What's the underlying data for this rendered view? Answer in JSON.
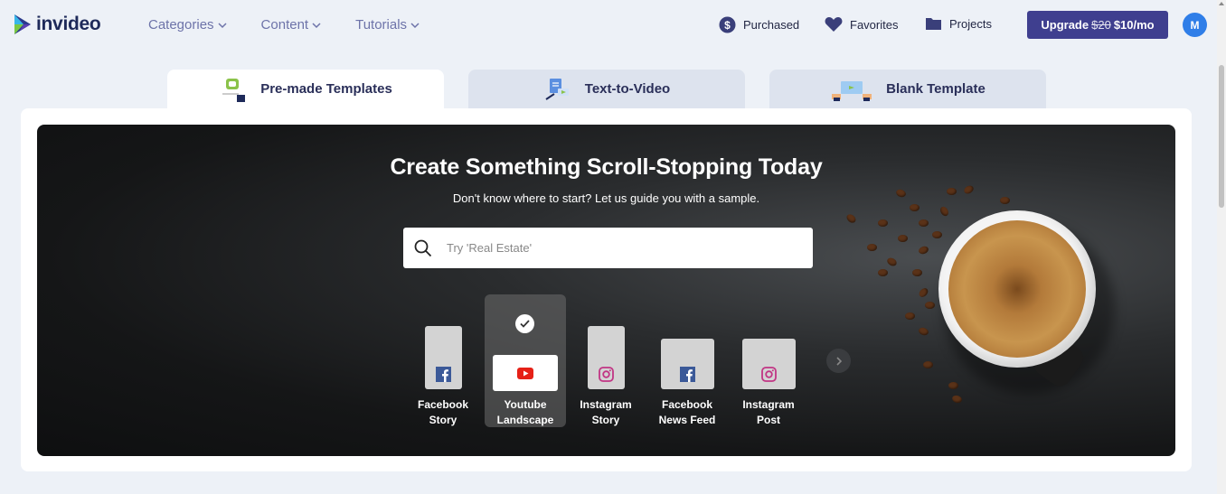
{
  "brand": {
    "name": "invideo"
  },
  "nav": {
    "items": [
      {
        "label": "Categories"
      },
      {
        "label": "Content"
      },
      {
        "label": "Tutorials"
      }
    ]
  },
  "account": {
    "purchased": "Purchased",
    "favorites": "Favorites",
    "projects": "Projects",
    "upgrade_prefix": "Upgrade",
    "upgrade_old_price": "$20",
    "upgrade_new_price": "$10/mo",
    "avatar_initial": "M"
  },
  "tabs": [
    {
      "label": "Pre-made Templates",
      "active": true
    },
    {
      "label": "Text-to-Video",
      "active": false
    },
    {
      "label": "Blank Template",
      "active": false
    }
  ],
  "hero": {
    "title": "Create Something Scroll-Stopping Today",
    "subtitle": "Don't know where to start? Let us guide you with a sample.",
    "search_placeholder": "Try 'Real Estate'"
  },
  "formats": [
    {
      "label_line1": "Facebook",
      "label_line2": "Story",
      "platform": "facebook-icon",
      "selected": false
    },
    {
      "label_line1": "Youtube",
      "label_line2": "Landscape",
      "platform": "youtube-icon",
      "selected": true
    },
    {
      "label_line1": "Instagram",
      "label_line2": "Story",
      "platform": "instagram-icon",
      "selected": false
    },
    {
      "label_line1": "Facebook",
      "label_line2": "News Feed",
      "platform": "facebook-icon",
      "selected": false
    },
    {
      "label_line1": "Instagram",
      "label_line2": "Post",
      "platform": "instagram-icon",
      "selected": false
    }
  ],
  "colors": {
    "brand_navy": "#1e2a5a",
    "upgrade_button": "#3f3f8f",
    "avatar": "#2f7ee8",
    "nav_text": "#6d73a9",
    "facebook": "#3b5998",
    "youtube": "#e62117",
    "instagram": "#c13584"
  }
}
